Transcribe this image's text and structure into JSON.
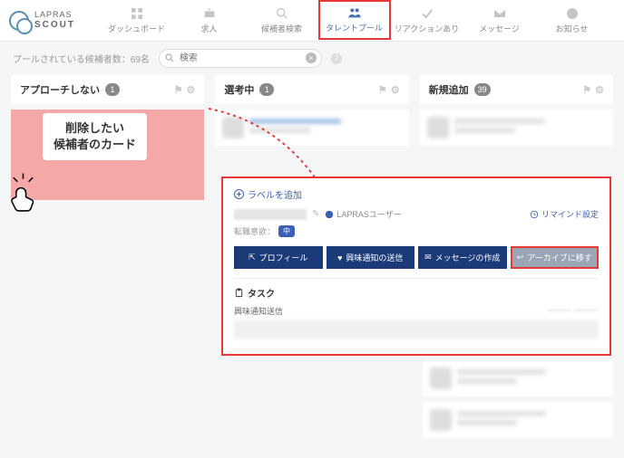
{
  "logo": {
    "line1": "LAPRAS",
    "line2": "SCOUT"
  },
  "nav": {
    "dashboard": "ダッシュボード",
    "jobs": "求人",
    "search": "候補者検索",
    "pool": "タレントプール",
    "reaction": "リアクションあり",
    "message": "メッセージ",
    "notice": "お知らせ"
  },
  "subbar": {
    "count_label": "プールされている候補者数：69名",
    "search_placeholder": "検索"
  },
  "columns": {
    "c1": {
      "title": "アプローチしない",
      "count": "1"
    },
    "c2": {
      "title": "選考中",
      "count": "1"
    },
    "c3": {
      "title": "新規追加",
      "count": "39"
    }
  },
  "callout": {
    "line1": "削除したい",
    "line2": "候補者のカード"
  },
  "popup": {
    "add_label": "ラベルを追加",
    "lapras_user": "LAPRASユーザー",
    "remind": "リマインド設定",
    "sub_prefix": "転職意欲：",
    "sub_chip": "中",
    "btn_profile": "プロフィール",
    "btn_interest": "興味通知の送信",
    "btn_message": "メッセージの作成",
    "btn_archive": "アーカイブに移す",
    "tasks_title": "タスク",
    "task1": "興味通知送信"
  }
}
